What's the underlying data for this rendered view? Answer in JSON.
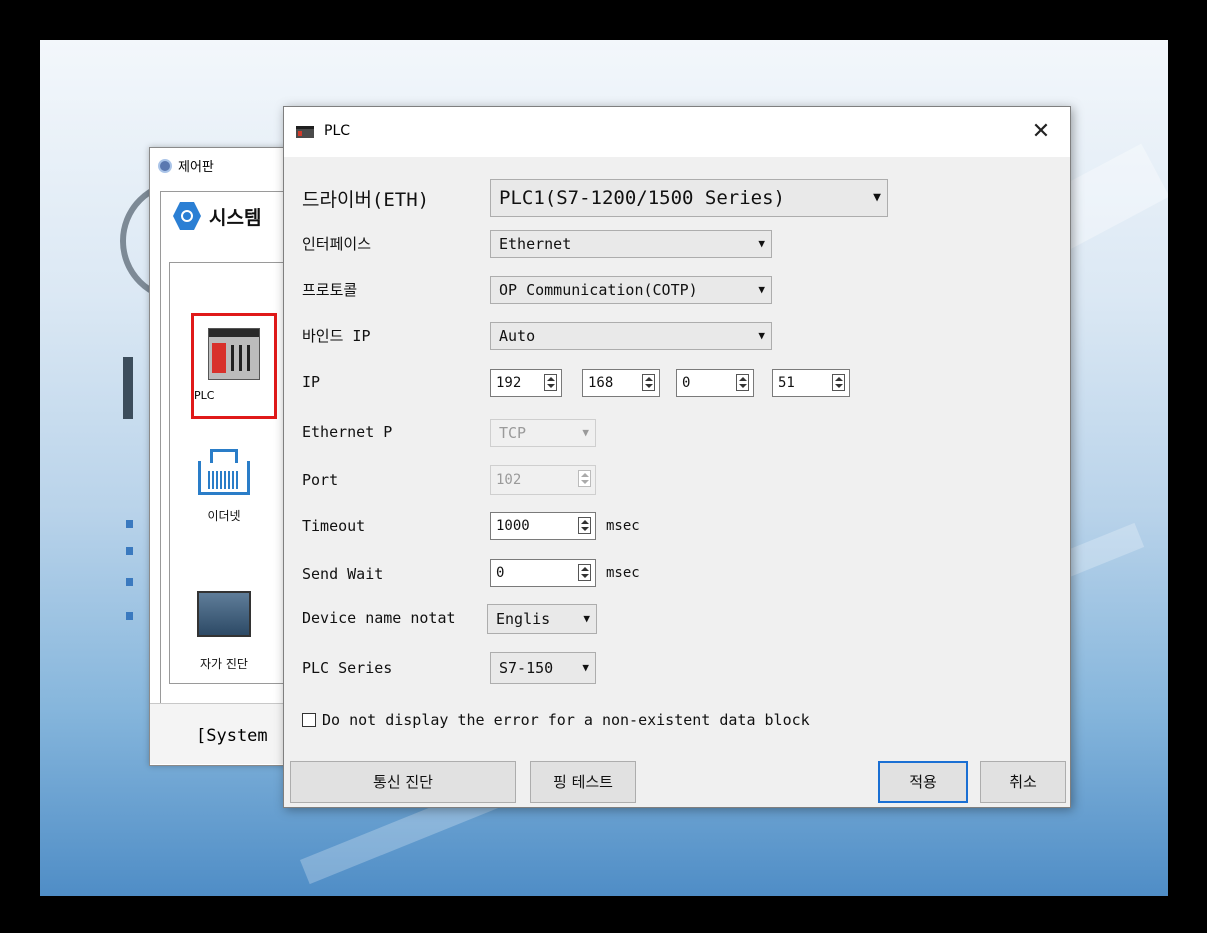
{
  "control_panel": {
    "title": "제어판",
    "header": "시스템",
    "items": [
      {
        "label": "PLC"
      },
      {
        "label": "이더넷"
      },
      {
        "label": "자가 진단"
      }
    ],
    "footer": "[System"
  },
  "dialog": {
    "title": "PLC",
    "rows": {
      "driver": {
        "label": "드라이버(ETH)",
        "value": "PLC1(S7-1200/1500 Series)"
      },
      "interface": {
        "label": "인터페이스",
        "value": "Ethernet"
      },
      "protocol": {
        "label": "프로토콜",
        "value": "OP Communication(COTP)"
      },
      "bind_ip": {
        "label": "바인드 IP",
        "value": "Auto"
      },
      "ip": {
        "label": "IP",
        "octets": [
          "192",
          "168",
          "0",
          "51"
        ]
      },
      "ethernet_p": {
        "label": "Ethernet P",
        "value": "TCP"
      },
      "port": {
        "label": "Port",
        "value": "102"
      },
      "timeout": {
        "label": "Timeout",
        "value": "1000",
        "unit": "msec"
      },
      "send_wait": {
        "label": "Send Wait",
        "value": "0",
        "unit": "msec"
      },
      "device_name": {
        "label": "Device name notat",
        "value": "Englis"
      },
      "plc_series": {
        "label": "PLC Series",
        "value": "S7-150"
      }
    },
    "checkbox": {
      "label": "Do not display the error for a non-existent data block",
      "checked": false
    },
    "buttons": {
      "diag": "통신 진단",
      "ping": "핑 테스트",
      "apply": "적용",
      "cancel": "취소"
    }
  }
}
